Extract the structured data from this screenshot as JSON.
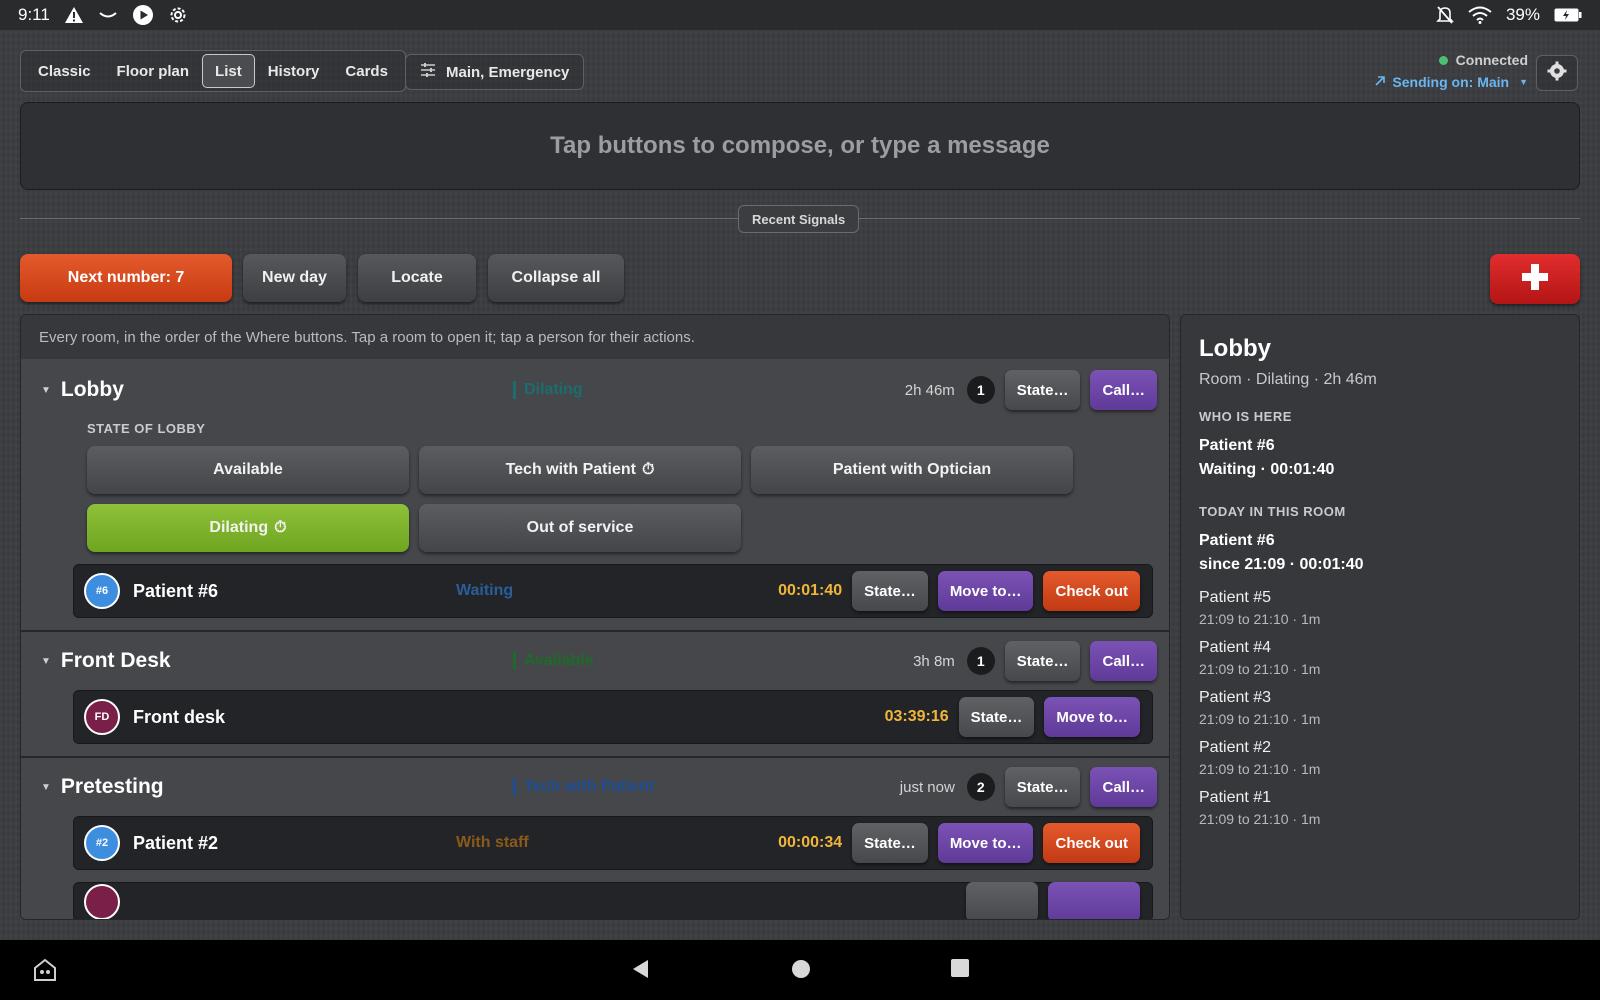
{
  "statusbar": {
    "time": "9:11",
    "battery": "39%"
  },
  "nav": {
    "tabs": [
      "Classic",
      "Floor plan",
      "List",
      "History",
      "Cards"
    ],
    "active": "List",
    "filter_label": "Main, Emergency"
  },
  "connection": {
    "status": "Connected",
    "sending": "Sending on: Main"
  },
  "compose": {
    "placeholder": "Tap buttons to compose, or type a message"
  },
  "recent_signals": "Recent Signals",
  "actions": {
    "next_number": "Next number: 7",
    "new_day": "New day",
    "locate": "Locate",
    "collapse_all": "Collapse all"
  },
  "list": {
    "hint": "Every room, in the order of the Where buttons. Tap a room to open it; tap a person for their actions.",
    "state_btn": "State…",
    "call_btn": "Call…",
    "move_btn": "Move to…",
    "checkout_btn": "Check out",
    "rooms": [
      {
        "name": "Lobby",
        "state": "Dilating",
        "time": "2h 46m",
        "count": "1",
        "state_label": "STATE OF LOBBY",
        "state_options": [
          "Available",
          "Tech with Patient",
          "Patient with Optician",
          "Dilating",
          "Out of service"
        ],
        "people": [
          {
            "avatar": "#6",
            "name": "Patient #6",
            "status": "Waiting",
            "timer": "00:01:40"
          }
        ]
      },
      {
        "name": "Front Desk",
        "state": "Available",
        "time": "3h 8m",
        "count": "1",
        "people": [
          {
            "avatar": "FD",
            "name": "Front desk",
            "status": "",
            "timer": "03:39:16"
          }
        ]
      },
      {
        "name": "Pretesting",
        "state": "Tech with Patient",
        "time": "just now",
        "count": "2",
        "people": [
          {
            "avatar": "#2",
            "name": "Patient #2",
            "status": "With staff",
            "timer": "00:00:34"
          }
        ]
      }
    ]
  },
  "side": {
    "title": "Lobby",
    "subtitle": "Room · Dilating · 2h 46m",
    "who_label": "WHO IS HERE",
    "who_name": "Patient #6",
    "who_status": "Waiting · 00:01:40",
    "today_label": "TODAY IN THIS ROOM",
    "today_current_name": "Patient #6",
    "today_current_since": "since 21:09 · 00:01:40",
    "history": [
      {
        "name": "Patient #5",
        "range": "21:09 to 21:10 · 1m"
      },
      {
        "name": "Patient #4",
        "range": "21:09 to 21:10 · 1m"
      },
      {
        "name": "Patient #3",
        "range": "21:09 to 21:10 · 1m"
      },
      {
        "name": "Patient #2",
        "range": "21:09 to 21:10 · 1m"
      },
      {
        "name": "Patient #1",
        "range": "21:09 to 21:10 · 1m"
      }
    ]
  },
  "colors": {
    "accent_orange": "#d8481c",
    "purple": "#6a44a6",
    "green": "#7fb52c",
    "timer": "#f0b63a",
    "connected": "#4cc070"
  }
}
